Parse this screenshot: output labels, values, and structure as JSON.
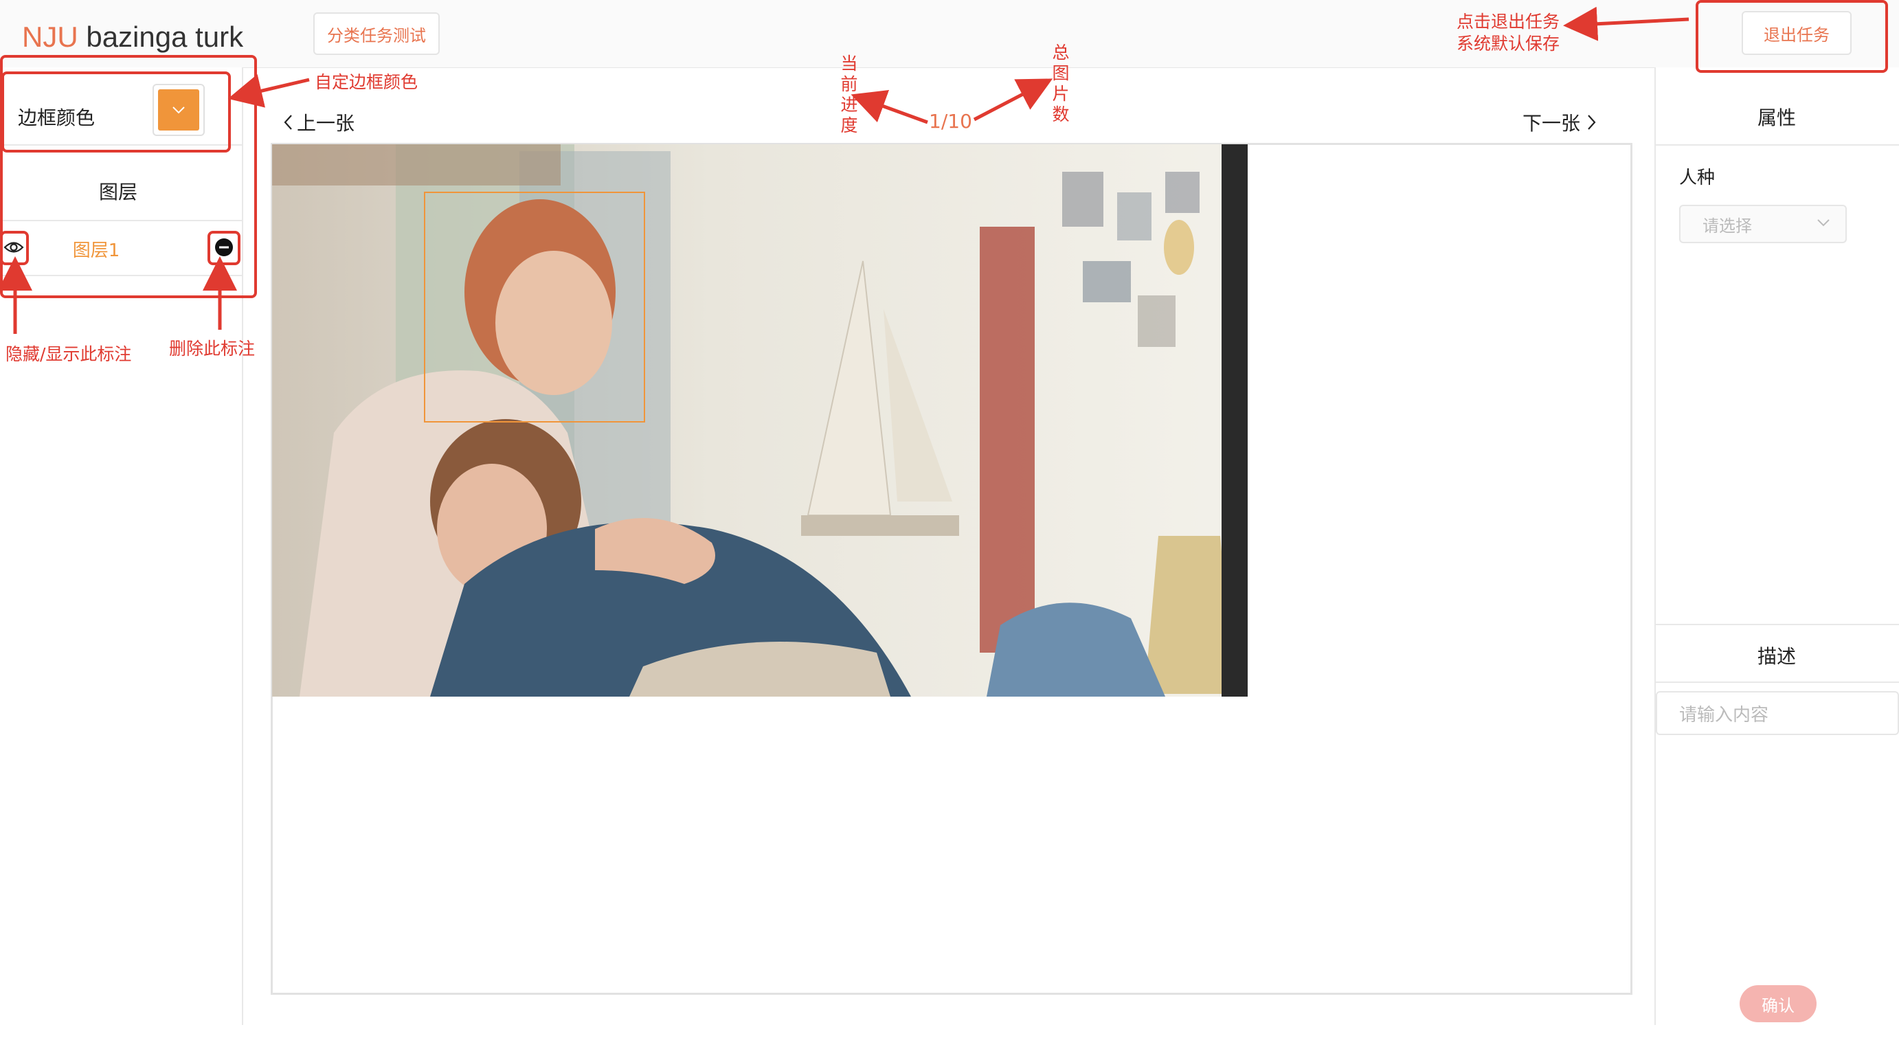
{
  "header": {
    "logo_prefix": "NJU",
    "logo_rest": " bazinga turk",
    "task_button": "分类任务测试",
    "exit_button": "退出任务"
  },
  "sidebar": {
    "border_color_label": "边框颜色",
    "border_color_value": "#f0953a",
    "layers_title": "图层",
    "layers": [
      {
        "name": "图层1"
      }
    ]
  },
  "canvas": {
    "prev_label": "上一张",
    "next_label": "下一张",
    "progress": "1/10"
  },
  "right_panel": {
    "attributes_title": "属性",
    "race_label": "人种",
    "race_placeholder": "请选择",
    "description_title": "描述",
    "description_placeholder": "请输入内容",
    "confirm_button": "确认"
  },
  "annotations": {
    "custom_border_color": "自定边框颜色",
    "current_progress": "当前进度",
    "total_images": "总图片数",
    "exit_note_line1": "点击退出任务",
    "exit_note_line2": "系统默认保存",
    "hide_show": "隐藏/显示此标注",
    "delete": "删除此标注",
    "color": "#e03a30"
  }
}
